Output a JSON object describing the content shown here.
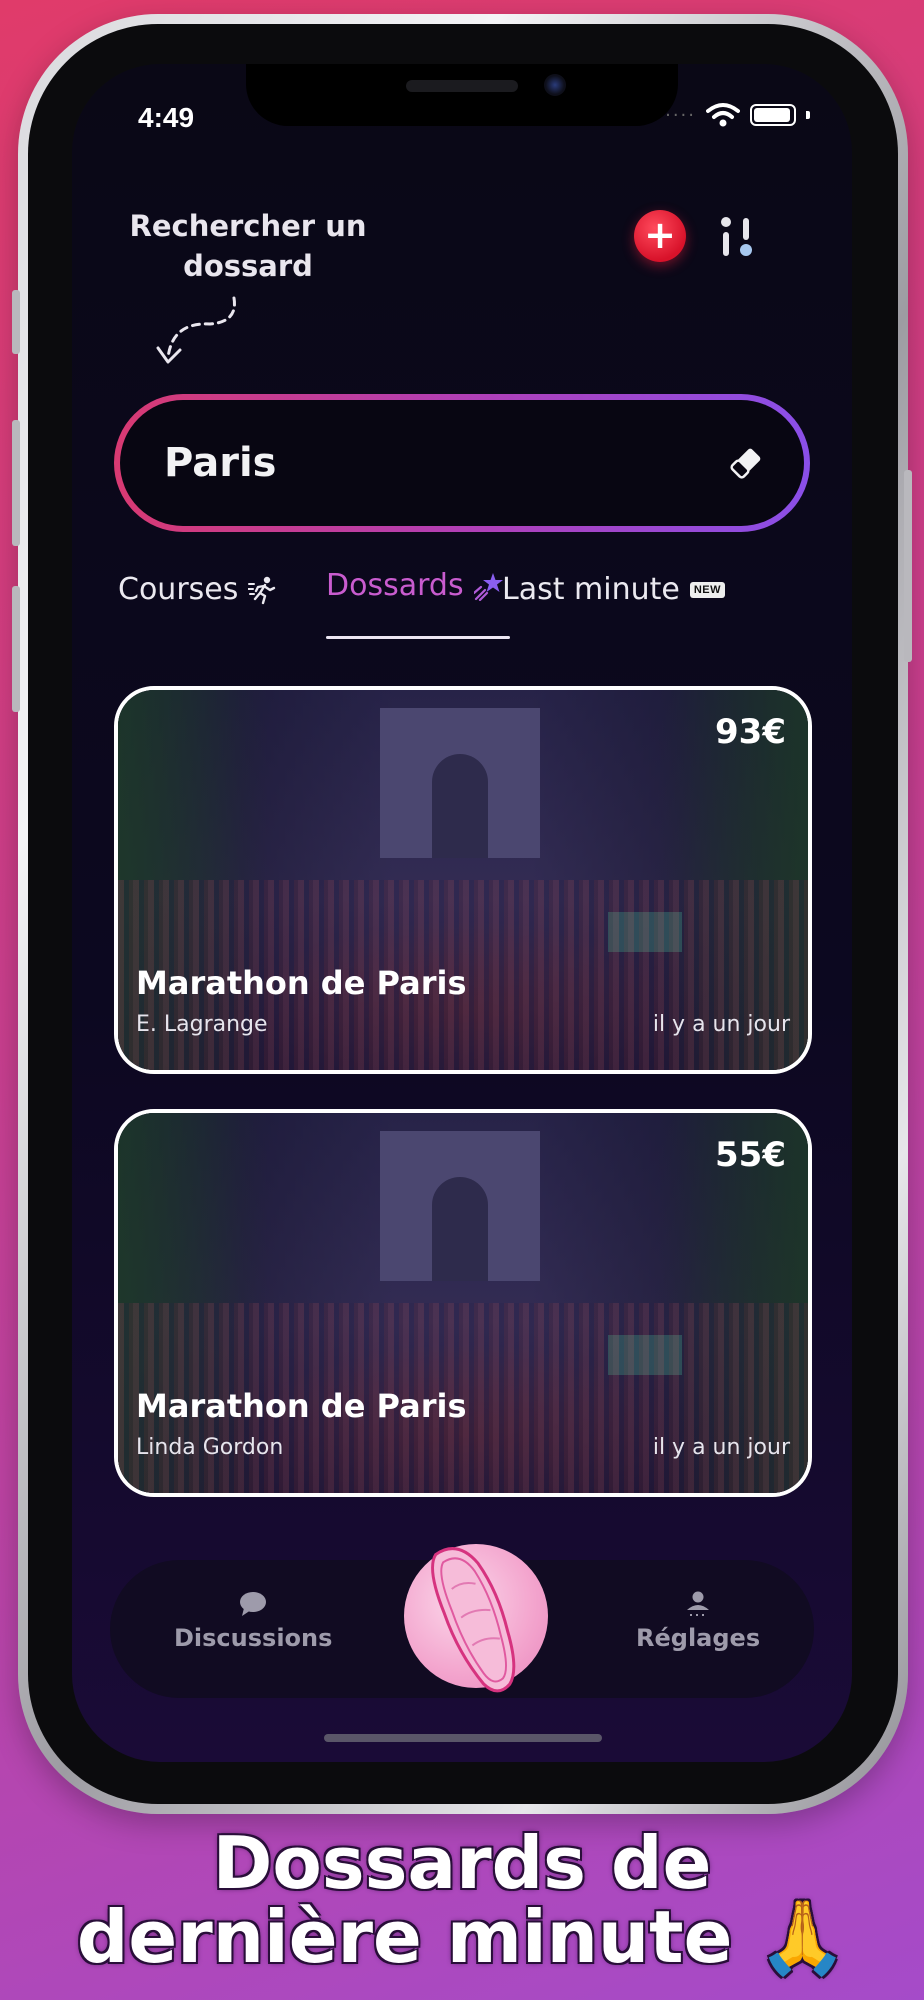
{
  "status_bar": {
    "time": "4:49"
  },
  "header": {
    "hint": "Rechercher un dossard",
    "add_label": "+"
  },
  "search": {
    "value": "Paris"
  },
  "tabs": [
    {
      "label": "Courses",
      "icon": "runner-icon",
      "active": false
    },
    {
      "label": "Dossards",
      "icon": "shooting-star-icon",
      "active": true
    },
    {
      "label": "Last minute",
      "icon": "new-badge-icon",
      "badge": "NEW",
      "active": false
    }
  ],
  "listings": [
    {
      "price": "93€",
      "title": "Marathon de Paris",
      "author": "E. Lagrange",
      "time": "il y a un jour"
    },
    {
      "price": "55€",
      "title": "Marathon de Paris",
      "author": "Linda Gordon",
      "time": "il y a un jour"
    }
  ],
  "tabbar": {
    "left": {
      "label": "Discussions",
      "icon": "chat-bubble-icon"
    },
    "center": {
      "icon": "shoe-icon"
    },
    "right": {
      "label": "Réglages",
      "icon": "user-icon"
    }
  },
  "caption": {
    "line1": "Dossards de",
    "line2": "dernière minute 🙏"
  },
  "colors": {
    "accent_pink": "#d83a72",
    "accent_purple": "#8a4fe8",
    "add_red": "#d8122a",
    "active_tab": "#c95ccf",
    "background": "#0a0816"
  }
}
